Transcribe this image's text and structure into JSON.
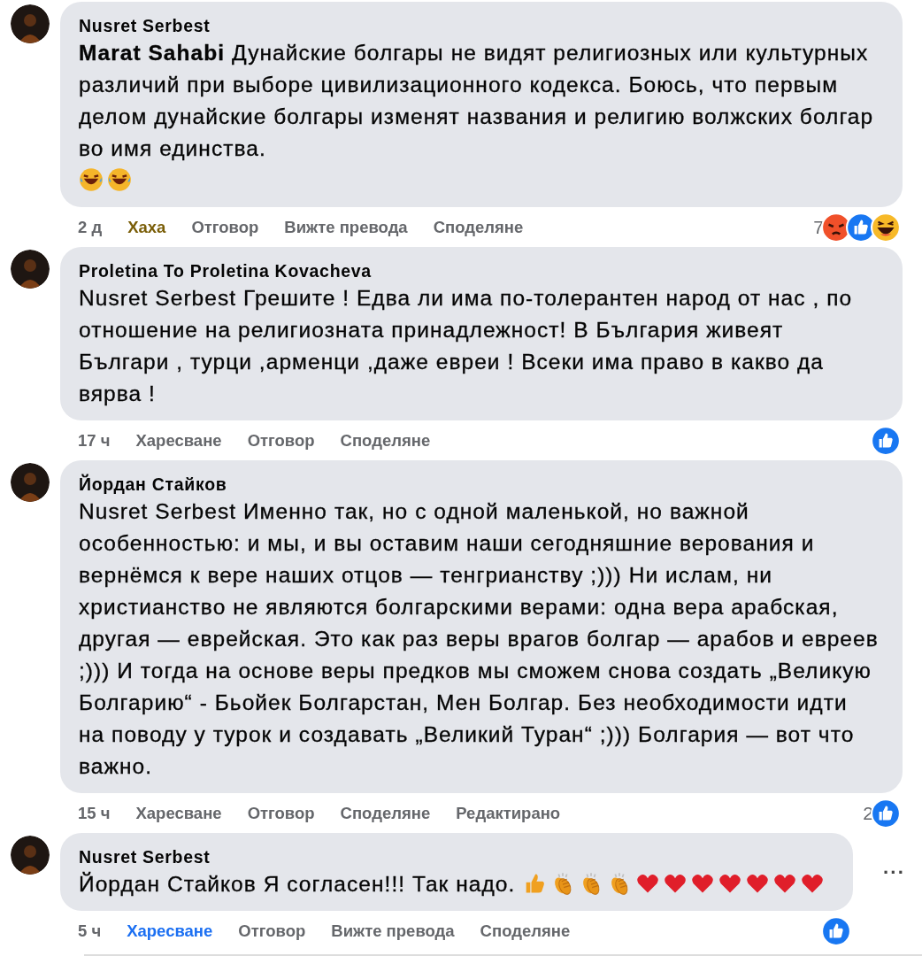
{
  "comments": [
    {
      "author": "Nusret Serbest",
      "text": "**Marat Sahabi** Дунайские болгары не видят религиозных или культурных различий при выборе цивилизационного кодекса. Боюсь, что первым делом дунайские болгары изменят названия и религию волжских болгар во имя единства.",
      "emojis": [
        {
          "kind": "laugh"
        },
        {
          "kind": "laugh"
        }
      ],
      "time": "2 д",
      "actions": [
        {
          "label": "Хаха",
          "color": "#7a5e08"
        },
        {
          "label": "Отговор"
        },
        {
          "label": "Вижте превода"
        },
        {
          "label": "Споделяне"
        }
      ],
      "reactions": {
        "count": "7",
        "icons": [
          {
            "kind": "angry"
          },
          {
            "kind": "like"
          },
          {
            "kind": "laugh"
          }
        ]
      }
    },
    {
      "author": "Proletina To Proletina Kovacheva",
      "text": "Nusret Serbest Грешите ! Едва ли има по-толерантен народ от нас , по отношение на религиозната принадлежност! В България живеят Българи , турци ,арменци ,даже евреи ! Всеки има право в какво да вярва !",
      "time": "17 ч",
      "actions": [
        {
          "label": "Харесване"
        },
        {
          "label": "Отговор"
        },
        {
          "label": "Споделяне"
        }
      ],
      "reactions": {
        "icons": [
          {
            "kind": "like"
          }
        ]
      }
    },
    {
      "author": "Йордан Стайков",
      "text": "Nusret Serbest Именно так, но с одной маленькой, но важной особенностью: и мы, и вы оставим наши сегодняшние верования и вернёмся к вере наших отцов — тенгрианству ;))) Ни ислам, ни христианство не являются болгарскими верами: одна вера арабская, другая — еврейская. Это как раз веры врагов болгар — арабов и евреев ;))) И тогда на основе веры предков мы сможем снова создать „Великую Болгарию“ - Бьойек Болгарстан, Мен Болгар. Без необходимости идти на поводу у турок и создавать „Великий Туран“ ;))) Болгария — вот что важно.",
      "time": "15 ч",
      "actions": [
        {
          "label": "Харесване"
        },
        {
          "label": "Отговор"
        },
        {
          "label": "Споделяне"
        },
        {
          "label": "Редактирано"
        }
      ],
      "reactions": {
        "count": "2",
        "icons": [
          {
            "kind": "like"
          }
        ]
      }
    },
    {
      "author": "Nusret Serbest",
      "text": "Йордан Стайков Я согласен!!! Так надо.",
      "emojis": [
        {
          "kind": "thumbs"
        },
        {
          "kind": "clap"
        },
        {
          "kind": "clap"
        },
        {
          "kind": "clap"
        },
        {
          "kind": "heart"
        },
        {
          "kind": "heart"
        },
        {
          "kind": "heart"
        },
        {
          "kind": "heart"
        },
        {
          "kind": "heart"
        },
        {
          "kind": "heart"
        },
        {
          "kind": "heart"
        }
      ],
      "more": "···",
      "time": "5 ч",
      "actions": [
        {
          "label": "Харесване",
          "color": "#1b6ff2"
        },
        {
          "label": "Отговор"
        },
        {
          "label": "Вижте превода"
        },
        {
          "label": "Споделяне"
        }
      ],
      "reactions": {
        "icons": [
          {
            "kind": "like"
          }
        ]
      }
    }
  ]
}
